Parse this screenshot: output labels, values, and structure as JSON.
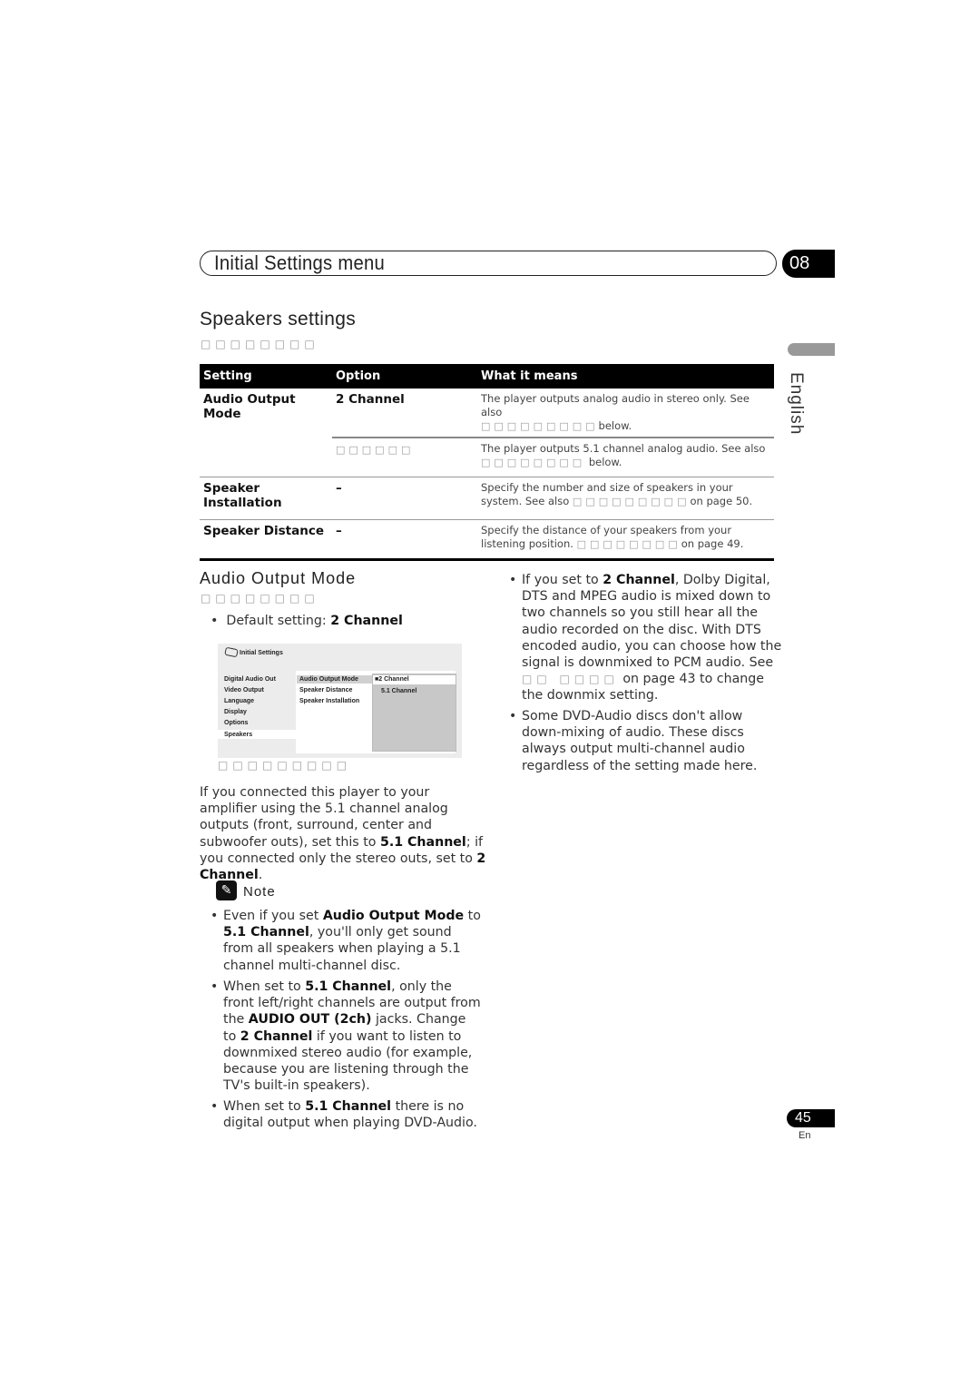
{
  "header": {
    "chapter_title": "Initial Settings menu",
    "chapter_number": "08"
  },
  "section": {
    "title": "Speakers settings",
    "subtitle_glyphs": "□□□□□□□□",
    "language_tab": "English"
  },
  "table": {
    "columns": [
      "Setting",
      "Option",
      "What it means"
    ],
    "rows": [
      {
        "setting": "Audio Output Mode",
        "option": "2 Channel",
        "meaning": "The player outputs analog audio in stereo only. See also",
        "meaning_ref": "□□□□□□□□□",
        "meaning_tail": "below."
      },
      {
        "setting": "",
        "option": "□□□□□□",
        "meaning": "The player outputs 5.1 channel analog audio. See also",
        "meaning_ref": "□□□□□□□□",
        "meaning_tail": "below."
      },
      {
        "setting": "Speaker Installation",
        "option": "–",
        "meaning": "Specify the number and size of speakers in your system. See also",
        "meaning_ref": "□□□□□□□□□",
        "meaning_tail": "on page 50."
      },
      {
        "setting": "Speaker Distance",
        "option": "–",
        "meaning": "Specify the distance of your speakers from your listening position.",
        "meaning_ref": "□□□□□□□□",
        "meaning_tail": "on page 49."
      }
    ]
  },
  "audio_output_mode": {
    "title": "Audio Output Mode",
    "subtitle_glyphs": "□□□□□□□□",
    "default_prefix": "Default setting: ",
    "default_value": "2 Channel",
    "screen": {
      "title": "Initial Settings",
      "menu": [
        "Digital Audio Out",
        "Video Output",
        "Language",
        "Display",
        "Options",
        "Speakers"
      ],
      "submenu": [
        "Audio Output Mode",
        "Speaker Distance",
        "Speaker Installation"
      ],
      "options": [
        "2 Channel",
        "5.1 Channel"
      ],
      "selected_option_marker": "■",
      "caption_glyphs": "□□□□□□□□□"
    },
    "paragraph": {
      "part1": "If you connected this player to your amplifier using the 5.1 channel analog outputs (front, surround, center and subwoofer outs), set this to ",
      "bold1": "5.1 Channel",
      "part2": "; if you connected only the stereo outs, set to ",
      "bold2": "2 Channel",
      "part3": "."
    },
    "note": {
      "label": "Note",
      "items": [
        {
          "t1": "Even if you set ",
          "b1": "Audio Output Mode",
          "t2": " to ",
          "b2": "5.1 Channel",
          "t3": ", you'll only get sound from all speakers when playing a 5.1 channel multi-channel disc."
        },
        {
          "t1": "When set to ",
          "b1": "5.1 Channel",
          "t2": ", only the front left/right channels are output from the ",
          "b2": "AUDIO OUT (2ch)",
          "t3": " jacks. Change to ",
          "b3": "2 Channel",
          "t4": " if you want to listen to downmixed stereo audio (for example, because you are listening through the TV's built-in speakers)."
        },
        {
          "t1": "When set to ",
          "b1": "5.1 Channel",
          "t2": " there is no digital output when playing DVD-Audio."
        }
      ]
    },
    "right_bullets": [
      {
        "t1": "If you set to ",
        "b1": "2 Channel",
        "t2": ", Dolby Digital, DTS and MPEG audio is mixed down to two channels so you still hear all the audio recorded on the disc. With DTS encoded audio, you can choose how the signal is downmixed to PCM audio. See ",
        "g": "□□ □□□□",
        "t3": " on page 43 to change the downmix setting."
      },
      {
        "t1": "Some DVD-Audio discs don't allow down-mixing of audio. These discs always output multi-channel audio regardless of the setting made here."
      }
    ]
  },
  "footer": {
    "page_number": "45",
    "page_lang": "En"
  }
}
